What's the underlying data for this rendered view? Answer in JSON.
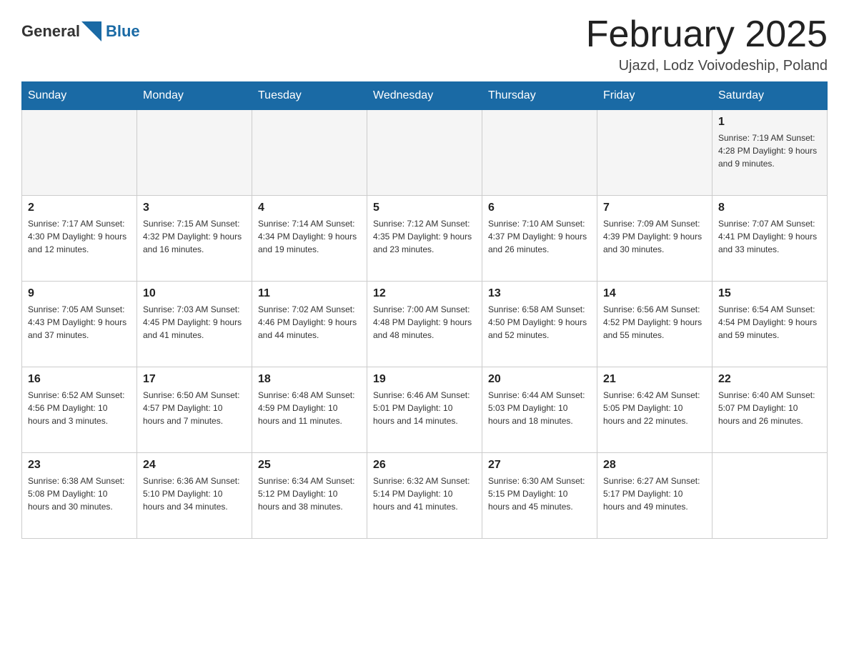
{
  "header": {
    "logo_general": "General",
    "logo_blue": "Blue",
    "title": "February 2025",
    "subtitle": "Ujazd, Lodz Voivodeship, Poland"
  },
  "days_of_week": [
    "Sunday",
    "Monday",
    "Tuesday",
    "Wednesday",
    "Thursday",
    "Friday",
    "Saturday"
  ],
  "weeks": [
    [
      {
        "day": "",
        "info": ""
      },
      {
        "day": "",
        "info": ""
      },
      {
        "day": "",
        "info": ""
      },
      {
        "day": "",
        "info": ""
      },
      {
        "day": "",
        "info": ""
      },
      {
        "day": "",
        "info": ""
      },
      {
        "day": "1",
        "info": "Sunrise: 7:19 AM\nSunset: 4:28 PM\nDaylight: 9 hours and 9 minutes."
      }
    ],
    [
      {
        "day": "2",
        "info": "Sunrise: 7:17 AM\nSunset: 4:30 PM\nDaylight: 9 hours and 12 minutes."
      },
      {
        "day": "3",
        "info": "Sunrise: 7:15 AM\nSunset: 4:32 PM\nDaylight: 9 hours and 16 minutes."
      },
      {
        "day": "4",
        "info": "Sunrise: 7:14 AM\nSunset: 4:34 PM\nDaylight: 9 hours and 19 minutes."
      },
      {
        "day": "5",
        "info": "Sunrise: 7:12 AM\nSunset: 4:35 PM\nDaylight: 9 hours and 23 minutes."
      },
      {
        "day": "6",
        "info": "Sunrise: 7:10 AM\nSunset: 4:37 PM\nDaylight: 9 hours and 26 minutes."
      },
      {
        "day": "7",
        "info": "Sunrise: 7:09 AM\nSunset: 4:39 PM\nDaylight: 9 hours and 30 minutes."
      },
      {
        "day": "8",
        "info": "Sunrise: 7:07 AM\nSunset: 4:41 PM\nDaylight: 9 hours and 33 minutes."
      }
    ],
    [
      {
        "day": "9",
        "info": "Sunrise: 7:05 AM\nSunset: 4:43 PM\nDaylight: 9 hours and 37 minutes."
      },
      {
        "day": "10",
        "info": "Sunrise: 7:03 AM\nSunset: 4:45 PM\nDaylight: 9 hours and 41 minutes."
      },
      {
        "day": "11",
        "info": "Sunrise: 7:02 AM\nSunset: 4:46 PM\nDaylight: 9 hours and 44 minutes."
      },
      {
        "day": "12",
        "info": "Sunrise: 7:00 AM\nSunset: 4:48 PM\nDaylight: 9 hours and 48 minutes."
      },
      {
        "day": "13",
        "info": "Sunrise: 6:58 AM\nSunset: 4:50 PM\nDaylight: 9 hours and 52 minutes."
      },
      {
        "day": "14",
        "info": "Sunrise: 6:56 AM\nSunset: 4:52 PM\nDaylight: 9 hours and 55 minutes."
      },
      {
        "day": "15",
        "info": "Sunrise: 6:54 AM\nSunset: 4:54 PM\nDaylight: 9 hours and 59 minutes."
      }
    ],
    [
      {
        "day": "16",
        "info": "Sunrise: 6:52 AM\nSunset: 4:56 PM\nDaylight: 10 hours and 3 minutes."
      },
      {
        "day": "17",
        "info": "Sunrise: 6:50 AM\nSunset: 4:57 PM\nDaylight: 10 hours and 7 minutes."
      },
      {
        "day": "18",
        "info": "Sunrise: 6:48 AM\nSunset: 4:59 PM\nDaylight: 10 hours and 11 minutes."
      },
      {
        "day": "19",
        "info": "Sunrise: 6:46 AM\nSunset: 5:01 PM\nDaylight: 10 hours and 14 minutes."
      },
      {
        "day": "20",
        "info": "Sunrise: 6:44 AM\nSunset: 5:03 PM\nDaylight: 10 hours and 18 minutes."
      },
      {
        "day": "21",
        "info": "Sunrise: 6:42 AM\nSunset: 5:05 PM\nDaylight: 10 hours and 22 minutes."
      },
      {
        "day": "22",
        "info": "Sunrise: 6:40 AM\nSunset: 5:07 PM\nDaylight: 10 hours and 26 minutes."
      }
    ],
    [
      {
        "day": "23",
        "info": "Sunrise: 6:38 AM\nSunset: 5:08 PM\nDaylight: 10 hours and 30 minutes."
      },
      {
        "day": "24",
        "info": "Sunrise: 6:36 AM\nSunset: 5:10 PM\nDaylight: 10 hours and 34 minutes."
      },
      {
        "day": "25",
        "info": "Sunrise: 6:34 AM\nSunset: 5:12 PM\nDaylight: 10 hours and 38 minutes."
      },
      {
        "day": "26",
        "info": "Sunrise: 6:32 AM\nSunset: 5:14 PM\nDaylight: 10 hours and 41 minutes."
      },
      {
        "day": "27",
        "info": "Sunrise: 6:30 AM\nSunset: 5:15 PM\nDaylight: 10 hours and 45 minutes."
      },
      {
        "day": "28",
        "info": "Sunrise: 6:27 AM\nSunset: 5:17 PM\nDaylight: 10 hours and 49 minutes."
      },
      {
        "day": "",
        "info": ""
      }
    ]
  ]
}
